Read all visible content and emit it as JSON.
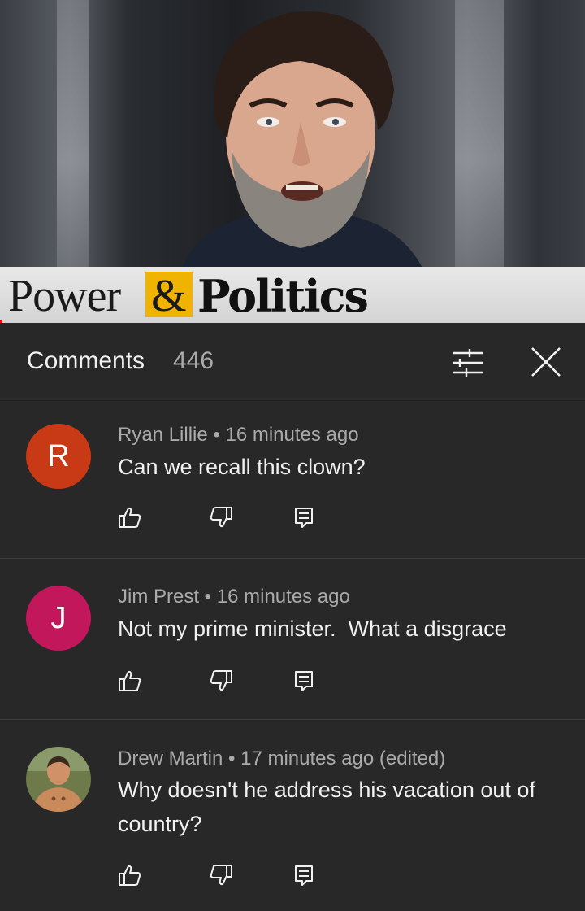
{
  "video": {
    "show_name_part1": "Power",
    "show_name_amp": "&",
    "show_name_part2": "Politics",
    "accent_color": "#f0b400"
  },
  "comments_panel": {
    "title": "Comments",
    "count": "446",
    "sort_icon": "sort-filter-icon",
    "close_icon": "close-icon"
  },
  "comments": [
    {
      "avatar_letter": "R",
      "avatar_color": "#c83a15",
      "author": "Ryan Lillie",
      "time": "16 minutes ago",
      "text": "Can we recall this clown?"
    },
    {
      "avatar_letter": "J",
      "avatar_color": "#c2185b",
      "author": "Jim Prest",
      "time": "16 minutes ago",
      "text": "Not my prime minister.  What a disgrace"
    },
    {
      "avatar_letter": "",
      "avatar_color": "",
      "author": "Drew Martin",
      "time": "17 minutes ago (edited)",
      "text": "Why doesn't he address his vacation out of country?"
    }
  ],
  "separator": " • "
}
